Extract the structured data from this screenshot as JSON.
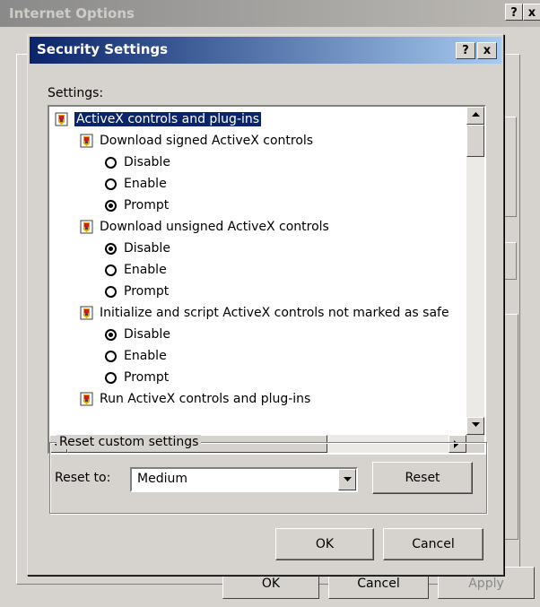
{
  "background_window": {
    "title": "Internet Options",
    "help_glyph": "?",
    "close_glyph": "x",
    "buttons": {
      "ok": "OK",
      "cancel": "Cancel",
      "apply": "Apply"
    }
  },
  "dialog": {
    "title": "Security Settings",
    "help_glyph": "?",
    "close_glyph": "x",
    "settings_label": "Settings:",
    "tree": {
      "category": {
        "label": "ActiveX controls and plug-ins",
        "icon": "settings-page-icon",
        "selected": true
      },
      "groups": [
        {
          "label": "Download signed ActiveX controls",
          "icon": "settings-page-icon",
          "options": [
            {
              "label": "Disable",
              "checked": false
            },
            {
              "label": "Enable",
              "checked": false
            },
            {
              "label": "Prompt",
              "checked": true
            }
          ]
        },
        {
          "label": "Download unsigned ActiveX controls",
          "icon": "settings-page-icon",
          "options": [
            {
              "label": "Disable",
              "checked": true
            },
            {
              "label": "Enable",
              "checked": false
            },
            {
              "label": "Prompt",
              "checked": false
            }
          ]
        },
        {
          "label": "Initialize and script ActiveX controls not marked as safe",
          "icon": "settings-page-icon",
          "options": [
            {
              "label": "Disable",
              "checked": true
            },
            {
              "label": "Enable",
              "checked": false
            },
            {
              "label": "Prompt",
              "checked": false
            }
          ]
        },
        {
          "label": "Run ActiveX controls and plug-ins",
          "icon": "settings-page-icon",
          "options": []
        }
      ]
    },
    "reset": {
      "group_label": "Reset custom settings",
      "reset_to_label": "Reset to:",
      "selected_level": "Medium",
      "reset_button": "Reset"
    },
    "buttons": {
      "ok": "OK",
      "cancel": "Cancel"
    }
  },
  "colors": {
    "title_active_start": "#0a246a",
    "title_active_end": "#a6caf0",
    "selection": "#0a246a",
    "face": "#d6d3ce"
  }
}
